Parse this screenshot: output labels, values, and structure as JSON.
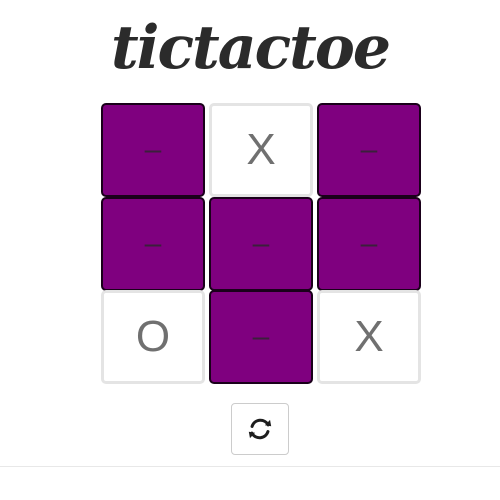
{
  "title": "tictactoe",
  "board": {
    "cells": [
      {
        "value": "–",
        "state": "empty"
      },
      {
        "value": "X",
        "state": "x"
      },
      {
        "value": "–",
        "state": "empty"
      },
      {
        "value": "–",
        "state": "empty"
      },
      {
        "value": "–",
        "state": "empty"
      },
      {
        "value": "–",
        "state": "empty"
      },
      {
        "value": "O",
        "state": "o"
      },
      {
        "value": "–",
        "state": "empty"
      },
      {
        "value": "X",
        "state": "x"
      }
    ]
  },
  "reset_button": {
    "icon": "refresh-icon"
  },
  "colors": {
    "empty_cell": "#7f007f",
    "marked_cell": "#ffffff",
    "mark_text": "#707070",
    "title": "#2b2b2b"
  }
}
